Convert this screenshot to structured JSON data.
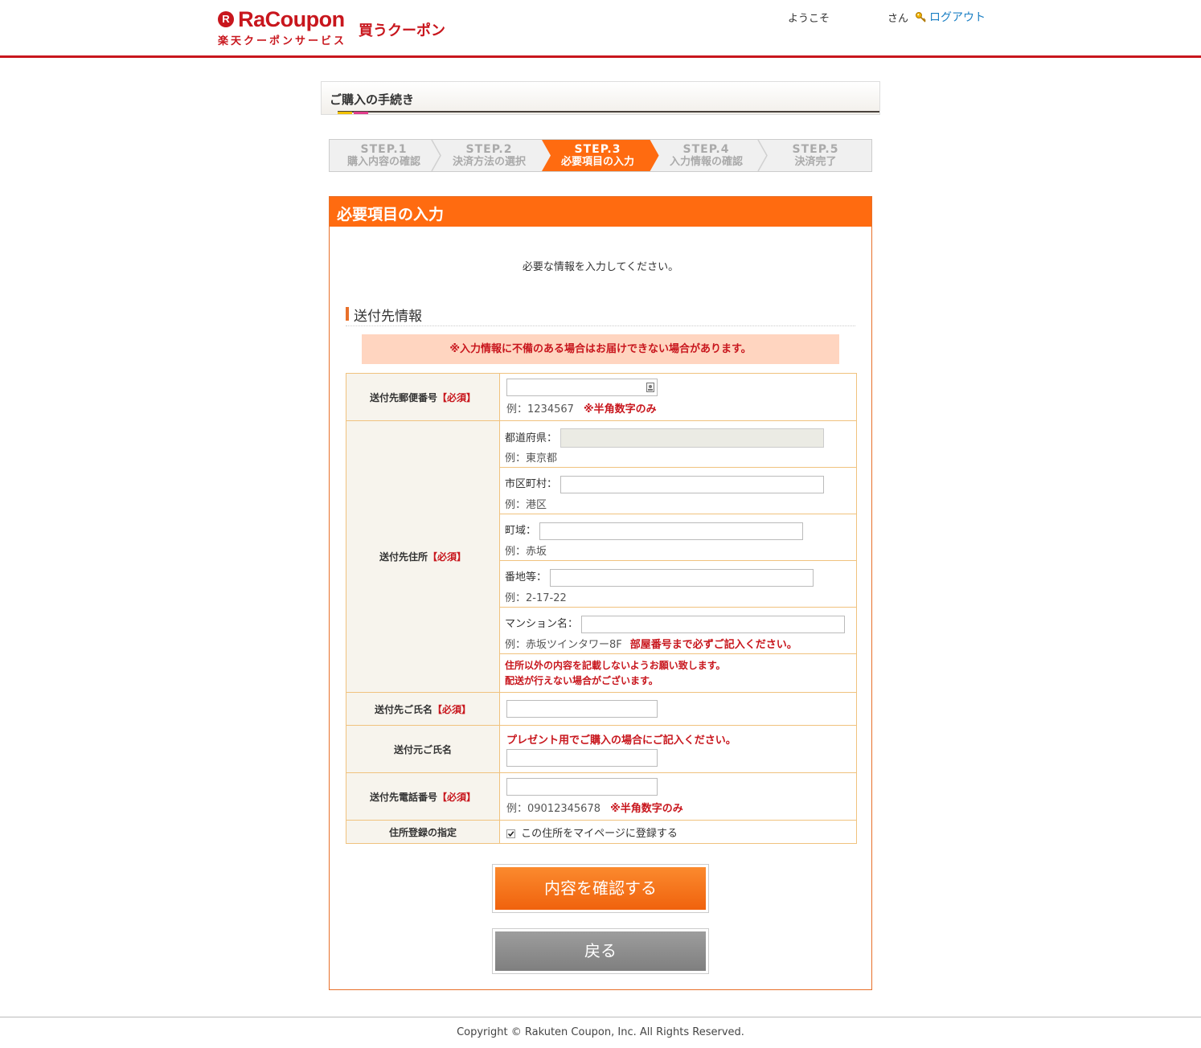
{
  "header": {
    "logo_mark": "R",
    "logo_text": "RaCoupon",
    "logo_sub": "楽天クーポンサービス",
    "logo_buy": "買うクーポン",
    "welcome": "ようこそ",
    "san": "さん",
    "logout": "ログアウト"
  },
  "procedure": {
    "title": "ご購入の手続き"
  },
  "steps": [
    {
      "num": "STEP.1",
      "label": "購入内容の確認"
    },
    {
      "num": "STEP.2",
      "label": "決済方法の選択"
    },
    {
      "num": "STEP.3",
      "label": "必要項目の入力",
      "active": true
    },
    {
      "num": "STEP.4",
      "label": "入力情報の確認"
    },
    {
      "num": "STEP.5",
      "label": "決済完了"
    }
  ],
  "main": {
    "title": "必要項目の入力",
    "intro": "必要な情報を入力してください。",
    "section_title": "送付先情報",
    "notice": "※入力情報に不備のある場合はお届けできない場合があります。"
  },
  "form": {
    "required_mark": "【必須】",
    "postal": {
      "label": "送付先郵便番号",
      "value": "",
      "example": "例：1234567",
      "note": "※半角数字のみ"
    },
    "address": {
      "label": "送付先住所",
      "prefecture": {
        "label": "都道府県：",
        "value": "",
        "example": "例：東京都"
      },
      "city": {
        "label": "市区町村：",
        "value": "",
        "example": "例：港区"
      },
      "town": {
        "label": "町域：",
        "value": "",
        "example": "例：赤坂"
      },
      "number": {
        "label": "番地等：",
        "value": "",
        "example": "例：2-17-22"
      },
      "building": {
        "label": "マンション名：",
        "value": "",
        "example": "例：赤坂ツインタワー8F",
        "note": "部屋番号まで必ずご記入ください。"
      },
      "warning_1": "住所以外の内容を記載しないようお願い致します。",
      "warning_2": "配送が行えない場合がございます。"
    },
    "recipient_name": {
      "label": "送付先ご氏名",
      "value": ""
    },
    "sender_name": {
      "label": "送付元ご氏名",
      "note": "プレゼント用でご購入の場合にご記入ください。",
      "value": ""
    },
    "phone": {
      "label": "送付先電話番号",
      "value": "",
      "example": "例：09012345678",
      "note": "※半角数字のみ"
    },
    "register": {
      "label": "住所登録の指定",
      "checkbox_label": "この住所をマイページに登録する",
      "checked": true
    }
  },
  "buttons": {
    "confirm": "内容を確認する",
    "back": "戻る"
  },
  "footer": {
    "copyright": "Copyright © Rakuten Coupon, Inc. All Rights Reserved."
  },
  "colors": {
    "brand": "#c8161d",
    "accent": "#ff6b10",
    "link": "#1a7fc4"
  }
}
